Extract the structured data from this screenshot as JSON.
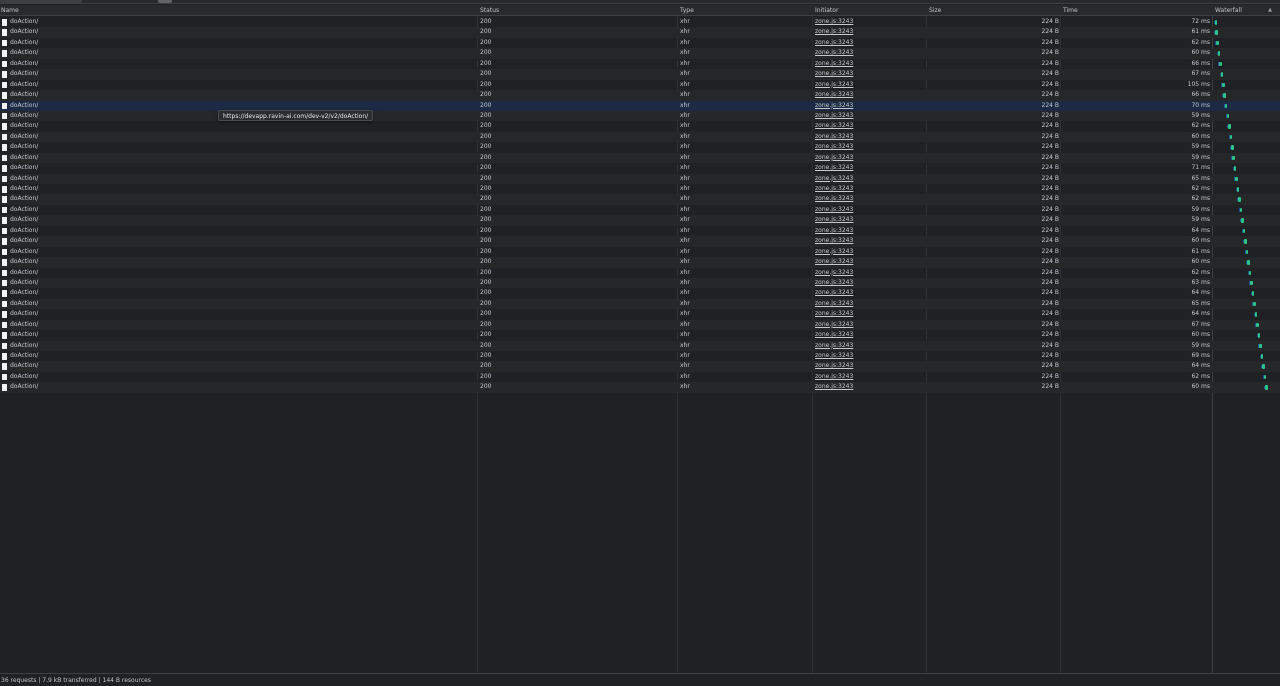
{
  "columns": {
    "name": "Name",
    "status": "Status",
    "type": "Type",
    "initiator": "Initiator",
    "size": "Size",
    "time": "Time",
    "waterfall": "Waterfall",
    "sort_indicator": "▲"
  },
  "tooltip": "https://devapp.ravin-ai.com/dev-v2/v2/doAction/",
  "selected_row_index": 8,
  "rows": [
    {
      "name": "doAction/",
      "status": "200",
      "type": "xhr",
      "initiator": "zone.js:3243",
      "size": "224 B",
      "time": "72 ms",
      "waterfall_start": 0.5
    },
    {
      "name": "doAction/",
      "status": "200",
      "type": "xhr",
      "initiator": "zone.js:3243",
      "size": "224 B",
      "time": "61 ms",
      "waterfall_start": 1.2
    },
    {
      "name": "doAction/",
      "status": "200",
      "type": "xhr",
      "initiator": "zone.js:3243",
      "size": "224 B",
      "time": "62 ms",
      "waterfall_start": 2.0
    },
    {
      "name": "doAction/",
      "status": "200",
      "type": "xhr",
      "initiator": "zone.js:3243",
      "size": "224 B",
      "time": "60 ms",
      "waterfall_start": 3.2
    },
    {
      "name": "doAction/",
      "status": "200",
      "type": "xhr",
      "initiator": "zone.js:3243",
      "size": "224 B",
      "time": "66 ms",
      "waterfall_start": 4.5
    },
    {
      "name": "doAction/",
      "status": "200",
      "type": "xhr",
      "initiator": "zone.js:3243",
      "size": "224 B",
      "time": "67 ms",
      "waterfall_start": 5.8
    },
    {
      "name": "doAction/",
      "status": "200",
      "type": "xhr",
      "initiator": "zone.js:3243",
      "size": "224 B",
      "time": "105 ms",
      "waterfall_start": 7.0
    },
    {
      "name": "doAction/",
      "status": "200",
      "type": "xhr",
      "initiator": "zone.js:3243",
      "size": "224 B",
      "time": "66 ms",
      "waterfall_start": 8.2
    },
    {
      "name": "doAction/",
      "status": "200",
      "type": "xhr",
      "initiator": "zone.js:3243",
      "size": "224 B",
      "time": "70 ms",
      "waterfall_start": 9.5
    },
    {
      "name": "doAction/",
      "status": "200",
      "type": "xhr",
      "initiator": "zone.js:3243",
      "size": "224 B",
      "time": "59 ms",
      "waterfall_start": 11.0
    },
    {
      "name": "doAction/",
      "status": "200",
      "type": "xhr",
      "initiator": "zone.js:3243",
      "size": "224 B",
      "time": "62 ms",
      "waterfall_start": 12.3
    },
    {
      "name": "doAction/",
      "status": "200",
      "type": "xhr",
      "initiator": "zone.js:3243",
      "size": "224 B",
      "time": "60 ms",
      "waterfall_start": 13.5
    },
    {
      "name": "doAction/",
      "status": "200",
      "type": "xhr",
      "initiator": "zone.js:3243",
      "size": "224 B",
      "time": "59 ms",
      "waterfall_start": 14.8
    },
    {
      "name": "doAction/",
      "status": "200",
      "type": "xhr",
      "initiator": "zone.js:3243",
      "size": "224 B",
      "time": "59 ms",
      "waterfall_start": 16.0
    },
    {
      "name": "doAction/",
      "status": "200",
      "type": "xhr",
      "initiator": "zone.js:3243",
      "size": "224 B",
      "time": "71 ms",
      "waterfall_start": 17.3
    },
    {
      "name": "doAction/",
      "status": "200",
      "type": "xhr",
      "initiator": "zone.js:3243",
      "size": "224 B",
      "time": "65 ms",
      "waterfall_start": 18.6
    },
    {
      "name": "doAction/",
      "status": "200",
      "type": "xhr",
      "initiator": "zone.js:3243",
      "size": "224 B",
      "time": "62 ms",
      "waterfall_start": 19.9
    },
    {
      "name": "doAction/",
      "status": "200",
      "type": "xhr",
      "initiator": "zone.js:3243",
      "size": "224 B",
      "time": "62 ms",
      "waterfall_start": 21.1
    },
    {
      "name": "doAction/",
      "status": "200",
      "type": "xhr",
      "initiator": "zone.js:3243",
      "size": "224 B",
      "time": "59 ms",
      "waterfall_start": 22.4
    },
    {
      "name": "doAction/",
      "status": "200",
      "type": "xhr",
      "initiator": "zone.js:3243",
      "size": "224 B",
      "time": "59 ms",
      "waterfall_start": 23.7
    },
    {
      "name": "doAction/",
      "status": "200",
      "type": "xhr",
      "initiator": "zone.js:3243",
      "size": "224 B",
      "time": "64 ms",
      "waterfall_start": 25.0
    },
    {
      "name": "doAction/",
      "status": "200",
      "type": "xhr",
      "initiator": "zone.js:3243",
      "size": "224 B",
      "time": "60 ms",
      "waterfall_start": 26.3
    },
    {
      "name": "doAction/",
      "status": "200",
      "type": "xhr",
      "initiator": "zone.js:3243",
      "size": "224 B",
      "time": "61 ms",
      "waterfall_start": 27.5
    },
    {
      "name": "doAction/",
      "status": "200",
      "type": "xhr",
      "initiator": "zone.js:3243",
      "size": "224 B",
      "time": "60 ms",
      "waterfall_start": 28.8
    },
    {
      "name": "doAction/",
      "status": "200",
      "type": "xhr",
      "initiator": "zone.js:3243",
      "size": "224 B",
      "time": "62 ms",
      "waterfall_start": 30.1
    },
    {
      "name": "doAction/",
      "status": "200",
      "type": "xhr",
      "initiator": "zone.js:3243",
      "size": "224 B",
      "time": "63 ms",
      "waterfall_start": 31.4
    },
    {
      "name": "doAction/",
      "status": "200",
      "type": "xhr",
      "initiator": "zone.js:3243",
      "size": "224 B",
      "time": "64 ms",
      "waterfall_start": 32.7
    },
    {
      "name": "doAction/",
      "status": "200",
      "type": "xhr",
      "initiator": "zone.js:3243",
      "size": "224 B",
      "time": "65 ms",
      "waterfall_start": 34.0
    },
    {
      "name": "doAction/",
      "status": "200",
      "type": "xhr",
      "initiator": "zone.js:3243",
      "size": "224 B",
      "time": "64 ms",
      "waterfall_start": 35.3
    },
    {
      "name": "doAction/",
      "status": "200",
      "type": "xhr",
      "initiator": "zone.js:3243",
      "size": "224 B",
      "time": "67 ms",
      "waterfall_start": 36.6
    },
    {
      "name": "doAction/",
      "status": "200",
      "type": "xhr",
      "initiator": "zone.js:3243",
      "size": "224 B",
      "time": "60 ms",
      "waterfall_start": 37.9
    },
    {
      "name": "doAction/",
      "status": "200",
      "type": "xhr",
      "initiator": "zone.js:3243",
      "size": "224 B",
      "time": "59 ms",
      "waterfall_start": 39.2
    },
    {
      "name": "doAction/",
      "status": "200",
      "type": "xhr",
      "initiator": "zone.js:3243",
      "size": "224 B",
      "time": "69 ms",
      "waterfall_start": 40.5
    },
    {
      "name": "doAction/",
      "status": "200",
      "type": "xhr",
      "initiator": "zone.js:3243",
      "size": "224 B",
      "time": "64 ms",
      "waterfall_start": 41.8
    },
    {
      "name": "doAction/",
      "status": "200",
      "type": "xhr",
      "initiator": "zone.js:3243",
      "size": "224 B",
      "time": "62 ms",
      "waterfall_start": 43.1
    },
    {
      "name": "doAction/",
      "status": "200",
      "type": "xhr",
      "initiator": "zone.js:3243",
      "size": "224 B",
      "time": "60 ms",
      "waterfall_start": 44.4
    }
  ],
  "footer": {
    "summary": "36 requests | 7.9 kB transferred | 144 B resources"
  },
  "colors": {
    "background": "#202124",
    "waterfall_bar": "#2bc48a",
    "selected_row": "#1c2a45"
  }
}
